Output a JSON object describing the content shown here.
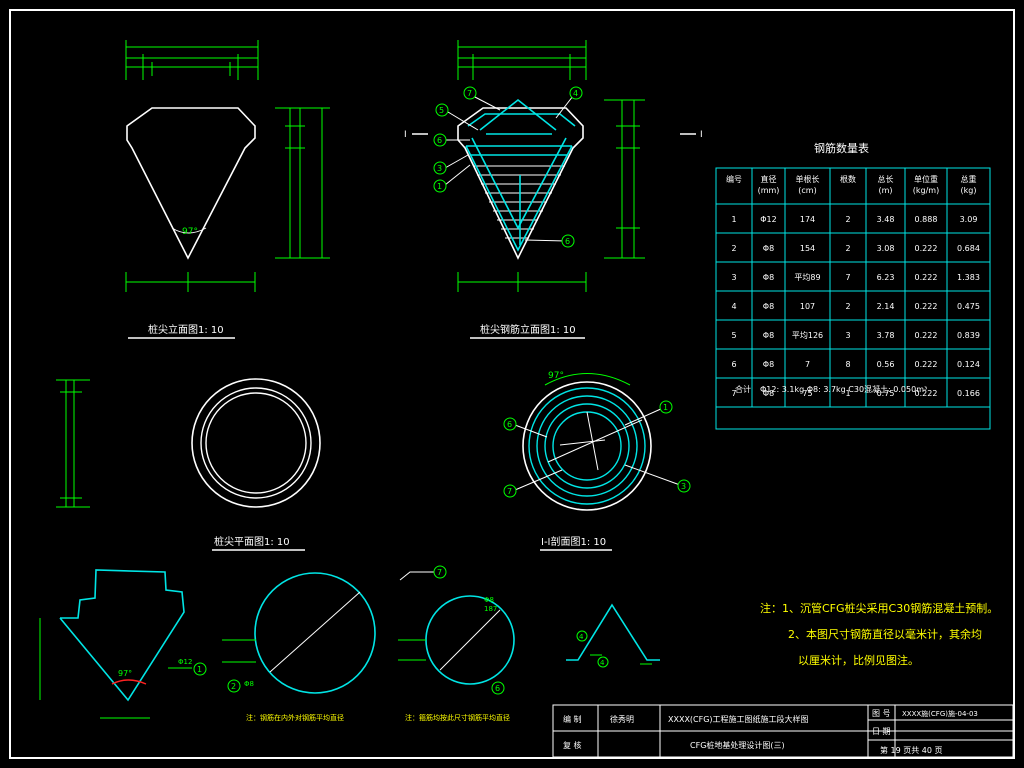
{
  "colors": {
    "background": "#000000",
    "line": "#ffffff",
    "dimension": "#00ff00",
    "rebar": "#00e5e5",
    "callout": "#00ff00",
    "note": "#ffff00",
    "hatch": "#ffffff"
  },
  "drawing": {
    "view_titles": {
      "front": "桩尖立面图1: 10",
      "rebar_front": "桩尖钢筋立面图1: 10",
      "plan": "桩尖平面图1: 10",
      "section": "I-I剖面图1: 10"
    },
    "section_mark": "I",
    "angle_label": "97°",
    "callouts": [
      "1",
      "2",
      "3",
      "4",
      "5",
      "6",
      "7"
    ],
    "circle_dims": [
      "Φ8",
      "Φ12",
      "187"
    ],
    "detail_notes": [
      "注：钢筋在内外对钢筋平均直径",
      "注：箍筋均按此尺寸钢筋平均直径"
    ]
  },
  "rebar_table": {
    "title": "钢筋数量表",
    "headers": [
      "编号",
      "直径\n(mm)",
      "单根长\n(cm)",
      "根数",
      "总长\n(m)",
      "单位重\n(kg/m)",
      "总重\n(kg)"
    ],
    "rows": [
      [
        "1",
        "Φ12",
        "174",
        "2",
        "3.48",
        "0.888",
        "3.09"
      ],
      [
        "2",
        "Φ8",
        "154",
        "2",
        "3.08",
        "0.222",
        "0.684"
      ],
      [
        "3",
        "Φ8",
        "平均89",
        "7",
        "6.23",
        "0.222",
        "1.383"
      ],
      [
        "4",
        "Φ8",
        "107",
        "2",
        "2.14",
        "0.222",
        "0.475"
      ],
      [
        "5",
        "Φ8",
        "平均126",
        "3",
        "3.78",
        "0.222",
        "0.839"
      ],
      [
        "6",
        "Φ8",
        "7",
        "8",
        "0.56",
        "0.222",
        "0.124"
      ],
      [
        "7",
        "Φ8",
        "75",
        "1",
        "0.75",
        "0.222",
        "0.166"
      ]
    ],
    "total_label": "合计",
    "total_text": "Φ12: 3.1kg   Φ8: 3.7kg   C30混凝土: 0.050m³"
  },
  "notes": {
    "line1": "注：1、沉管CFG桩尖采用C30钢筋混凝土预制。",
    "line2": "2、本图尺寸钢筋直径以毫米计，其余均",
    "line3": "以厘米计，比例见图注。"
  },
  "title_block": {
    "drawn_label": "编  制",
    "drawn_value": "徐秀明",
    "checked_label": "复  核",
    "project": "XXXX(CFG)工程施工图纸施工段大样图",
    "sheet_title": "CFG桩地基处理设计图(三)",
    "fig_no_label": "图  号",
    "fig_no": "XXXX施(CFG)施-04-03",
    "date_label": "日  期",
    "sheet_text": "第 19 页共 40 页"
  }
}
